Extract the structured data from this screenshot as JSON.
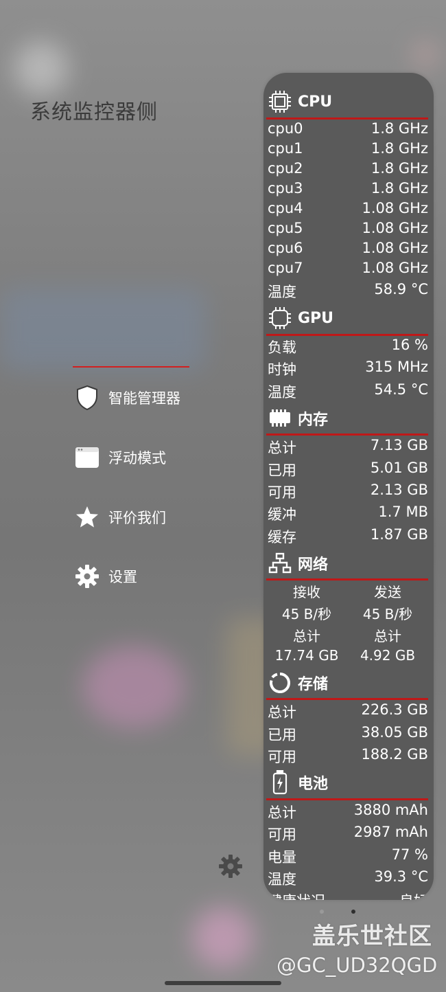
{
  "drawer": {
    "title": "系统监控器侧",
    "menu": [
      {
        "label": "智能管理器",
        "icon": "shield-icon"
      },
      {
        "label": "浮动模式",
        "icon": "window-icon"
      },
      {
        "label": "评价我们",
        "icon": "star-icon"
      },
      {
        "label": "设置",
        "icon": "gear-icon"
      }
    ],
    "accent_color": "#d21f1f"
  },
  "panel": {
    "cpu": {
      "title": "CPU",
      "rows": [
        {
          "k": "cpu0",
          "v": "1.8 GHz"
        },
        {
          "k": "cpu1",
          "v": "1.8 GHz"
        },
        {
          "k": "cpu2",
          "v": "1.8 GHz"
        },
        {
          "k": "cpu3",
          "v": "1.8 GHz"
        },
        {
          "k": "cpu4",
          "v": "1.08 GHz"
        },
        {
          "k": "cpu5",
          "v": "1.08 GHz"
        },
        {
          "k": "cpu6",
          "v": "1.08 GHz"
        },
        {
          "k": "cpu7",
          "v": "1.08 GHz"
        },
        {
          "k": "温度",
          "v": "58.9 °C"
        }
      ]
    },
    "gpu": {
      "title": "GPU",
      "rows": [
        {
          "k": "负载",
          "v": "16 %"
        },
        {
          "k": "时钟",
          "v": "315 MHz"
        },
        {
          "k": "温度",
          "v": "54.5 °C"
        }
      ]
    },
    "memory": {
      "title": "内存",
      "rows": [
        {
          "k": "总计",
          "v": "7.13 GB"
        },
        {
          "k": "已用",
          "v": "5.01 GB"
        },
        {
          "k": "可用",
          "v": "2.13 GB"
        },
        {
          "k": "缓冲",
          "v": "1.7 MB"
        },
        {
          "k": "缓存",
          "v": "1.87 GB"
        }
      ]
    },
    "network": {
      "title": "网络",
      "receive_label": "接收",
      "send_label": "发送",
      "receive_rate": "45 B/秒",
      "send_rate": "45 B/秒",
      "receive_total_label": "总计",
      "send_total_label": "总计",
      "receive_total": "17.74 GB",
      "send_total": "4.92 GB"
    },
    "storage": {
      "title": "存储",
      "rows": [
        {
          "k": "总计",
          "v": "226.3 GB"
        },
        {
          "k": "已用",
          "v": "38.05 GB"
        },
        {
          "k": "可用",
          "v": "188.2 GB"
        }
      ]
    },
    "battery": {
      "title": "电池",
      "rows": [
        {
          "k": "总计",
          "v": "3880 mAh"
        },
        {
          "k": "可用",
          "v": "2987 mAh"
        },
        {
          "k": "电量",
          "v": "77 %"
        },
        {
          "k": "温度",
          "v": "39.3 °C"
        },
        {
          "k": "健康状况",
          "v": "良好"
        }
      ]
    },
    "line_color": "#c01818"
  },
  "pager": {
    "count": 2,
    "active": 1
  },
  "watermark": {
    "line1": "盖乐世社区",
    "line2": "@GC_UD32QGD"
  }
}
